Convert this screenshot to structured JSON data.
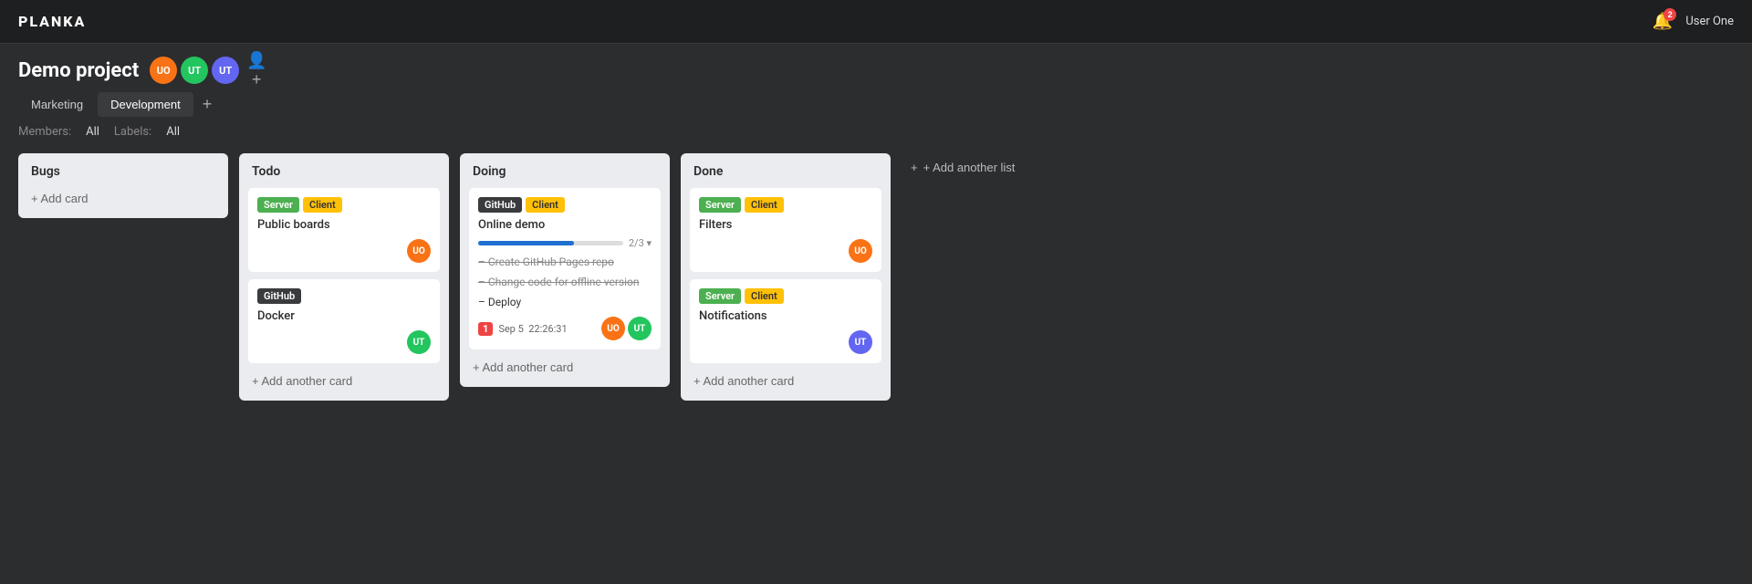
{
  "app": {
    "logo": "PLANKA"
  },
  "topnav": {
    "bell_badge": "2",
    "user_label": "User One"
  },
  "project": {
    "title": "Demo project",
    "avatars": [
      {
        "initials": "UO",
        "color": "#f97316",
        "label": "User One avatar"
      },
      {
        "initials": "UT",
        "color": "#22c55e",
        "label": "UT avatar 1"
      },
      {
        "initials": "UT",
        "color": "#6366f1",
        "label": "UT avatar 2"
      }
    ],
    "add_member_label": "+"
  },
  "tabs": [
    {
      "label": "Marketing",
      "active": false
    },
    {
      "label": "Development",
      "active": true
    }
  ],
  "filter": {
    "members_label": "Members:",
    "members_value": "All",
    "labels_label": "Labels:",
    "labels_value": "All"
  },
  "lists": [
    {
      "id": "bugs",
      "title": "Bugs",
      "cards": [],
      "add_card_label": "+ Add card"
    },
    {
      "id": "todo",
      "title": "Todo",
      "cards": [
        {
          "id": "todo-1",
          "labels": [
            {
              "text": "Server",
              "class": "label-green"
            },
            {
              "text": "Client",
              "class": "label-yellow"
            }
          ],
          "title": "Public boards",
          "avatar": {
            "initials": "UO",
            "color": "#f97316"
          }
        },
        {
          "id": "todo-2",
          "labels": [
            {
              "text": "GitHub",
              "class": "label-darkgray"
            }
          ],
          "title": "Docker",
          "avatar": {
            "initials": "UT",
            "color": "#22c55e"
          }
        }
      ],
      "add_card_label": "+ Add another card"
    },
    {
      "id": "doing",
      "title": "Doing",
      "cards": [
        {
          "id": "doing-1",
          "labels": [
            {
              "text": "GitHub",
              "class": "label-darkgray"
            },
            {
              "text": "Client",
              "class": "label-yellow"
            }
          ],
          "title": "Online demo",
          "has_edit_icon": true,
          "progress": {
            "percent": 66,
            "label": "2/3"
          },
          "checklist": [
            {
              "text": "– Create GitHub Pages repo",
              "done": true
            },
            {
              "text": "– Change code for offline version",
              "done": true
            },
            {
              "text": "– Deploy",
              "done": false
            }
          ],
          "meta": {
            "badge": "1",
            "date": "Sep 5",
            "time": "22:26:31",
            "avatars": [
              {
                "initials": "UO",
                "color": "#f97316"
              },
              {
                "initials": "UT",
                "color": "#22c55e"
              }
            ]
          }
        }
      ],
      "add_card_label": "+ Add another card"
    },
    {
      "id": "done",
      "title": "Done",
      "cards": [
        {
          "id": "done-1",
          "labels": [
            {
              "text": "Server",
              "class": "label-green"
            },
            {
              "text": "Client",
              "class": "label-yellow"
            }
          ],
          "title": "Filters",
          "avatar": {
            "initials": "UO",
            "color": "#f97316"
          }
        },
        {
          "id": "done-2",
          "labels": [
            {
              "text": "Server",
              "class": "label-green"
            },
            {
              "text": "Client",
              "class": "label-yellow"
            }
          ],
          "title": "Notifications",
          "avatar": {
            "initials": "UT",
            "color": "#6366f1"
          }
        }
      ],
      "add_card_label": "+ Add another card"
    }
  ],
  "add_list_label": "+ Add another list"
}
